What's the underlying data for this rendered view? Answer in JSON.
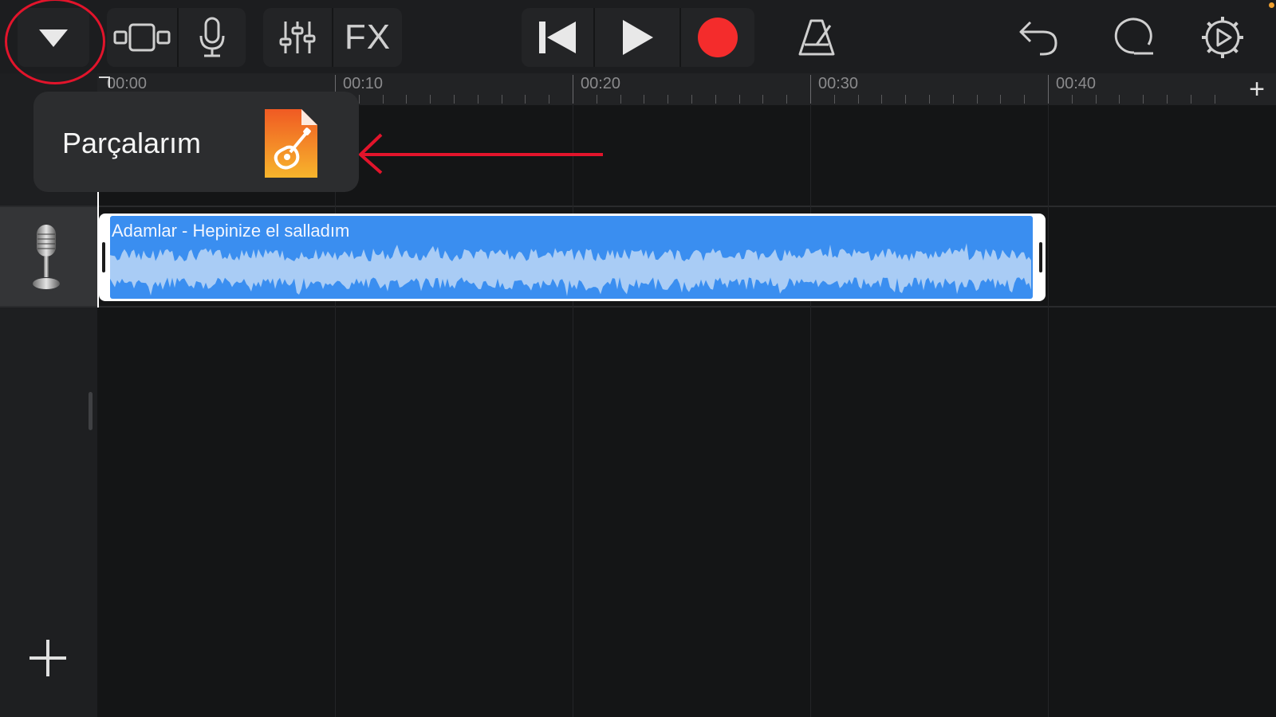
{
  "toolbar": {
    "menu_icon": "chevron-down-icon",
    "tracks_view_icon": "tracks-view-icon",
    "instrument_icon": "microphone-icon",
    "mixer_icon": "mixer-sliders-icon",
    "fx_label": "FX",
    "rewind_icon": "skip-to-start-icon",
    "play_icon": "play-icon",
    "record_icon": "record-icon",
    "record_color": "#f42c2c",
    "metronome_icon": "metronome-icon",
    "undo_icon": "undo-icon",
    "loop_icon": "loop-browser-icon",
    "settings_icon": "gear-icon"
  },
  "ruler": {
    "labels": [
      "00:00",
      "00:10",
      "00:20",
      "00:30",
      "00:40"
    ],
    "add_icon": "+"
  },
  "popover": {
    "label": "Parçalarım",
    "icon": "garageband-document-icon",
    "icon_colors": [
      "#f05a23",
      "#f7b52c"
    ]
  },
  "track": {
    "icon": "microphone-icon",
    "region_name": "Adamlar - Hepinize el salladım",
    "region_color": "#3a8ef0"
  },
  "add_track_icon": "plus-icon",
  "annotations": {
    "color": "#e2142b",
    "circle_target": "menu button",
    "arrow_target": "Parçalarım"
  }
}
